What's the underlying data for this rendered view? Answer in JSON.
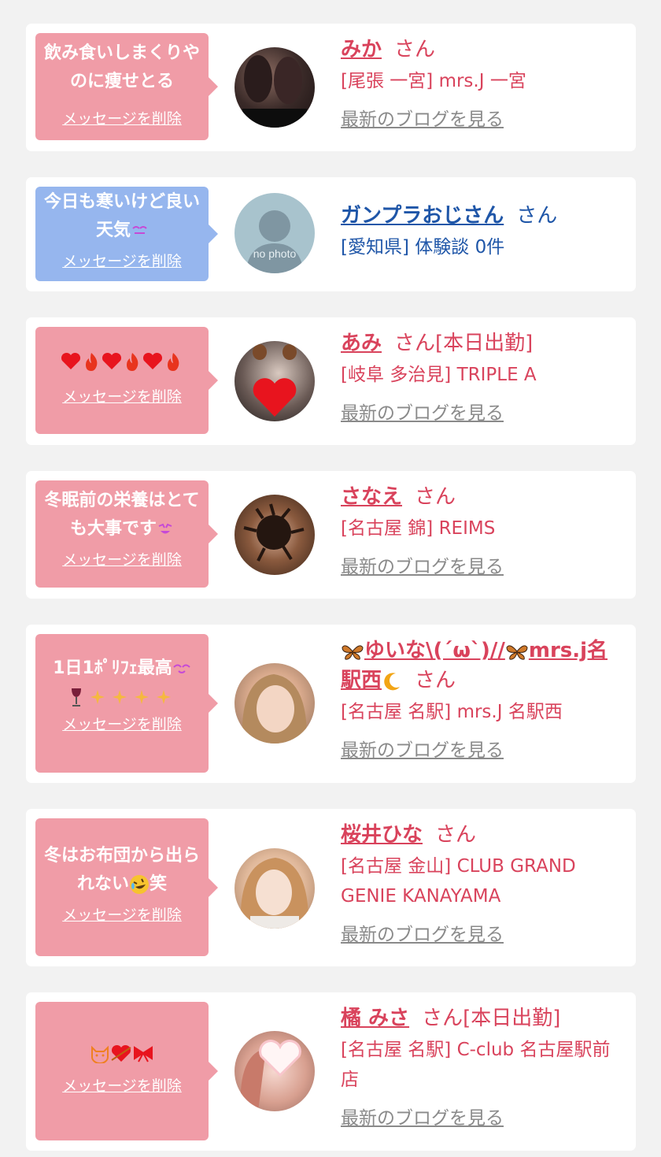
{
  "common": {
    "delete_label": "メッセージを削除",
    "blog_label": "最新のブログを見る"
  },
  "cards": [
    {
      "message": "飲み食いしまくりやのに痩せとる",
      "name": "みか",
      "suffix": "さん",
      "shop": "[尾張 一宮] mrs.J 一宮"
    },
    {
      "message": "今日も寒いけど良い天気",
      "name": "ガンプラおじさん",
      "suffix": "さん",
      "shop": "[愛知県] 体験談 0件",
      "avatar_text": "no photo"
    },
    {
      "message": "",
      "name": "あみ",
      "suffix": "さん[本日出勤]",
      "shop": "[岐阜 多治見] TRIPLE A"
    },
    {
      "message": "冬眠前の栄養はとても大事です",
      "name": "さなえ",
      "suffix": "さん",
      "shop": "[名古屋 錦] REIMS"
    },
    {
      "message": "1日1ﾎﾟﾘﾌｪ最高",
      "name": "ゆいな\\(´ω`)/",
      "name2": "mrs.j名駅西",
      "suffix": "さん",
      "shop": "[名古屋 名駅] mrs.J 名駅西"
    },
    {
      "message": "冬はお布団から出られない",
      "message_tail": "笑",
      "name": "桜井ひな",
      "suffix": "さん",
      "shop": "[名古屋 金山] CLUB GRAND GENIE KANAYAMA"
    },
    {
      "message": "",
      "name": "橘 みさ",
      "suffix": "さん[本日出勤]",
      "shop": "[名古屋 名駅] C-club 名古屋駅前店"
    }
  ],
  "colors": {
    "pink_bubble": "#f09ca7",
    "blue_bubble": "#96b6ee",
    "name_pink": "#d9435c",
    "name_blue": "#1f56a8",
    "link_gray": "#8a8a8a"
  }
}
